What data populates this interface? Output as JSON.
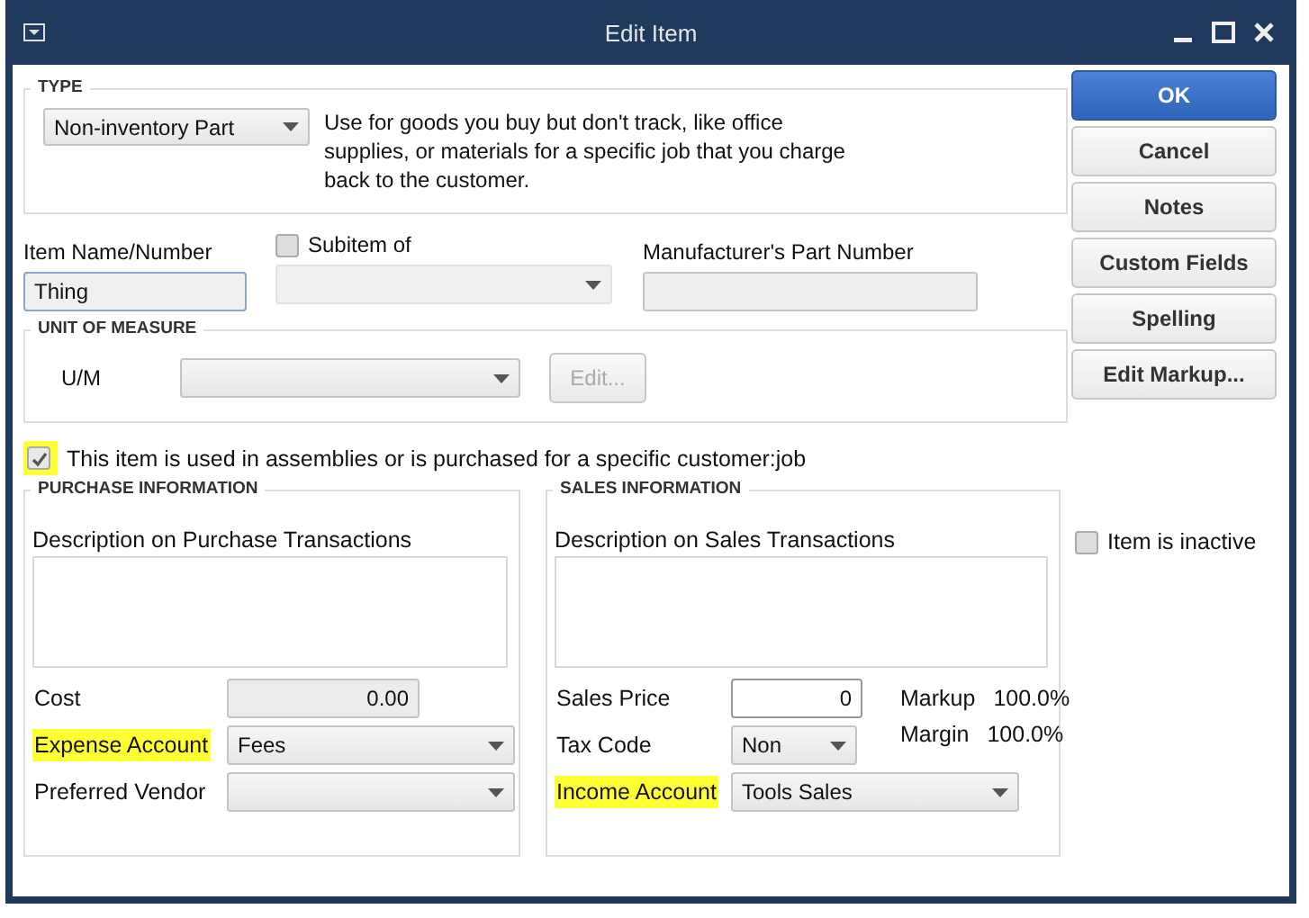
{
  "window": {
    "title": "Edit Item"
  },
  "type_section": {
    "heading": "TYPE",
    "value": "Non-inventory Part",
    "description": "Use for goods you buy but don't track, like office supplies, or materials for a specific job that you charge back to the customer."
  },
  "item_name": {
    "label": "Item Name/Number",
    "value": "Thing"
  },
  "subitem": {
    "label": "Subitem of",
    "checked": false
  },
  "manufacturer_part": {
    "label": "Manufacturer's Part Number"
  },
  "unit_of_measure": {
    "heading": "UNIT OF MEASURE",
    "label": "U/M",
    "edit_button": {
      "label": "Edit...",
      "disabled": true
    }
  },
  "assemblies": {
    "label": "This item is used in assemblies or is purchased for a specific customer:job",
    "checked": true,
    "highlighted": true
  },
  "purchase": {
    "heading": "PURCHASE INFORMATION",
    "description_label": "Description on Purchase Transactions",
    "fields": [
      {
        "label": "Cost",
        "kind": "amount",
        "value": "0.00",
        "highlighted": false
      },
      {
        "label": "Expense Account",
        "kind": "dropdown",
        "value": "Fees",
        "highlighted": true
      },
      {
        "label": "Preferred Vendor",
        "kind": "dropdown",
        "highlighted": false
      }
    ]
  },
  "sales": {
    "heading": "SALES INFORMATION",
    "description_label": "Description on Sales Transactions",
    "fields": [
      {
        "label": "Sales Price",
        "kind": "price",
        "value": "0",
        "highlighted": false
      },
      {
        "label": "Tax Code",
        "kind": "short_dropdown",
        "value": "Non",
        "highlighted": false
      },
      {
        "label": "Income Account",
        "kind": "dropdown",
        "value": "Tools Sales",
        "highlighted": true
      }
    ],
    "markup": {
      "label": "Markup",
      "value": "100.0%"
    },
    "margin": {
      "label": "Margin",
      "value": "100.0%"
    }
  },
  "buttons": [
    {
      "label": "OK",
      "primary": true
    },
    {
      "label": "Cancel",
      "primary": false
    },
    {
      "label": "Notes",
      "primary": false
    },
    {
      "label": "Custom Fields",
      "primary": false
    },
    {
      "label": "Spelling",
      "primary": false
    },
    {
      "label": "Edit Markup...",
      "primary": false
    }
  ],
  "item_inactive": {
    "label": "Item is inactive",
    "checked": false
  }
}
